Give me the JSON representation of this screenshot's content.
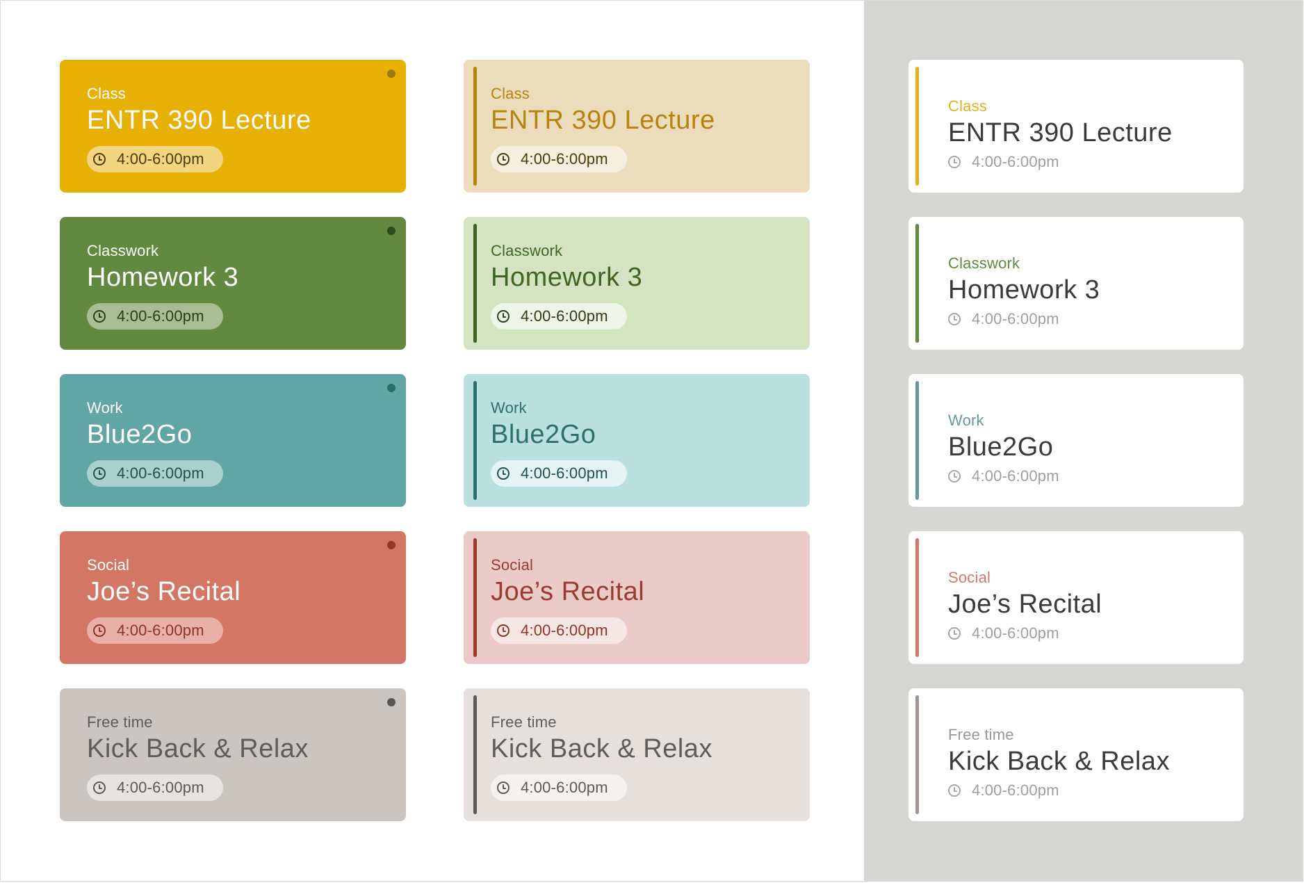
{
  "columns": {
    "solid": [
      {
        "category": "Class",
        "title": "ENTR 390 Lecture",
        "time": "4:00-6:00pm"
      },
      {
        "category": "Classwork",
        "title": "Homework 3",
        "time": "4:00-6:00pm"
      },
      {
        "category": "Work",
        "title": "Blue2Go",
        "time": "4:00-6:00pm"
      },
      {
        "category": "Social",
        "title": "Joe’s Recital",
        "time": "4:00-6:00pm"
      },
      {
        "category": "Free time",
        "title": "Kick Back & Relax",
        "time": "4:00-6:00pm"
      }
    ],
    "tinted": [
      {
        "category": "Class",
        "title": "ENTR 390 Lecture",
        "time": "4:00-6:00pm"
      },
      {
        "category": "Classwork",
        "title": "Homework 3",
        "time": "4:00-6:00pm"
      },
      {
        "category": "Work",
        "title": "Blue2Go",
        "time": "4:00-6:00pm"
      },
      {
        "category": "Social",
        "title": "Joe’s Recital",
        "time": "4:00-6:00pm"
      },
      {
        "category": "Free time",
        "title": "Kick Back & Relax",
        "time": "4:00-6:00pm"
      }
    ],
    "outlined": [
      {
        "category": "Class",
        "title": "ENTR 390 Lecture",
        "time": "4:00-6:00pm"
      },
      {
        "category": "Classwork",
        "title": "Homework 3",
        "time": "4:00-6:00pm"
      },
      {
        "category": "Work",
        "title": "Blue2Go",
        "time": "4:00-6:00pm"
      },
      {
        "category": "Social",
        "title": "Joe’s Recital",
        "time": "4:00-6:00pm"
      },
      {
        "category": "Free time",
        "title": "Kick Back & Relax",
        "time": "4:00-6:00pm"
      }
    ]
  },
  "colors": {
    "class": {
      "solid": "#e6b004",
      "dot": "#9a7a10",
      "pill": "#f2d580",
      "pill_text": "#4a3a08",
      "tint": "#ebdcbc",
      "accent": "#b7830f",
      "tint_pill": "#f6efe0",
      "outline_cat": "#e3b11c"
    },
    "classwork": {
      "solid": "#62893f",
      "dot": "#2c4a1a",
      "pill": "#a8bd92",
      "pill_text": "#2a3e18",
      "tint": "#d5e4c0",
      "accent": "#3f6522",
      "tint_pill": "#eef4e6",
      "outline_cat": "#5e8a3c"
    },
    "work": {
      "solid": "#61a6a5",
      "dot": "#2c6a6a",
      "pill": "#a9cfcf",
      "pill_text": "#1f4f4f",
      "tint": "#bae0e0",
      "accent": "#2f6e6f",
      "tint_pill": "#e6f3f3",
      "outline_cat": "#669a99"
    },
    "social": {
      "solid": "#d37665",
      "dot": "#8f3a2d",
      "pill": "#e8b0a6",
      "pill_text": "#8b3428",
      "tint": "#ebcbc8",
      "accent": "#9a3b33",
      "tint_pill": "#f6e6e4",
      "outline_cat": "#d4796a"
    },
    "free_time": {
      "solid": "#cac5c1",
      "dot": "#5a5654",
      "pill": "#e6e3e1",
      "pill_text": "#5c5856",
      "tint": "#e6e0dd",
      "accent": "#5f5b59",
      "tint_pill": "#f4f1f0",
      "outline_cat": "#9d9693"
    }
  },
  "icons": {
    "time": "clock-icon"
  }
}
